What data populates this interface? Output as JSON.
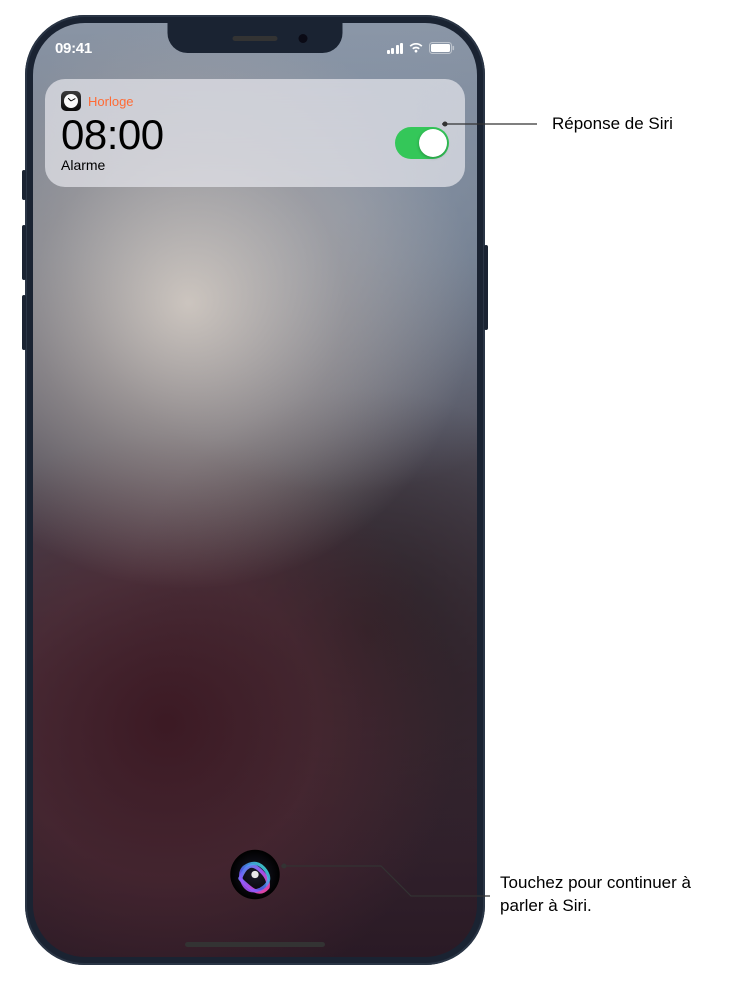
{
  "status_bar": {
    "time": "09:41"
  },
  "notification": {
    "app_name": "Horloge",
    "alarm_time": "08:00",
    "alarm_label": "Alarme",
    "toggle_on": true
  },
  "callouts": {
    "siri_response": "Réponse de Siri",
    "siri_button": "Touchez pour continuer à parler à Siri."
  },
  "colors": {
    "toggle_on": "#34c759",
    "app_name_accent": "#ff6b35"
  }
}
